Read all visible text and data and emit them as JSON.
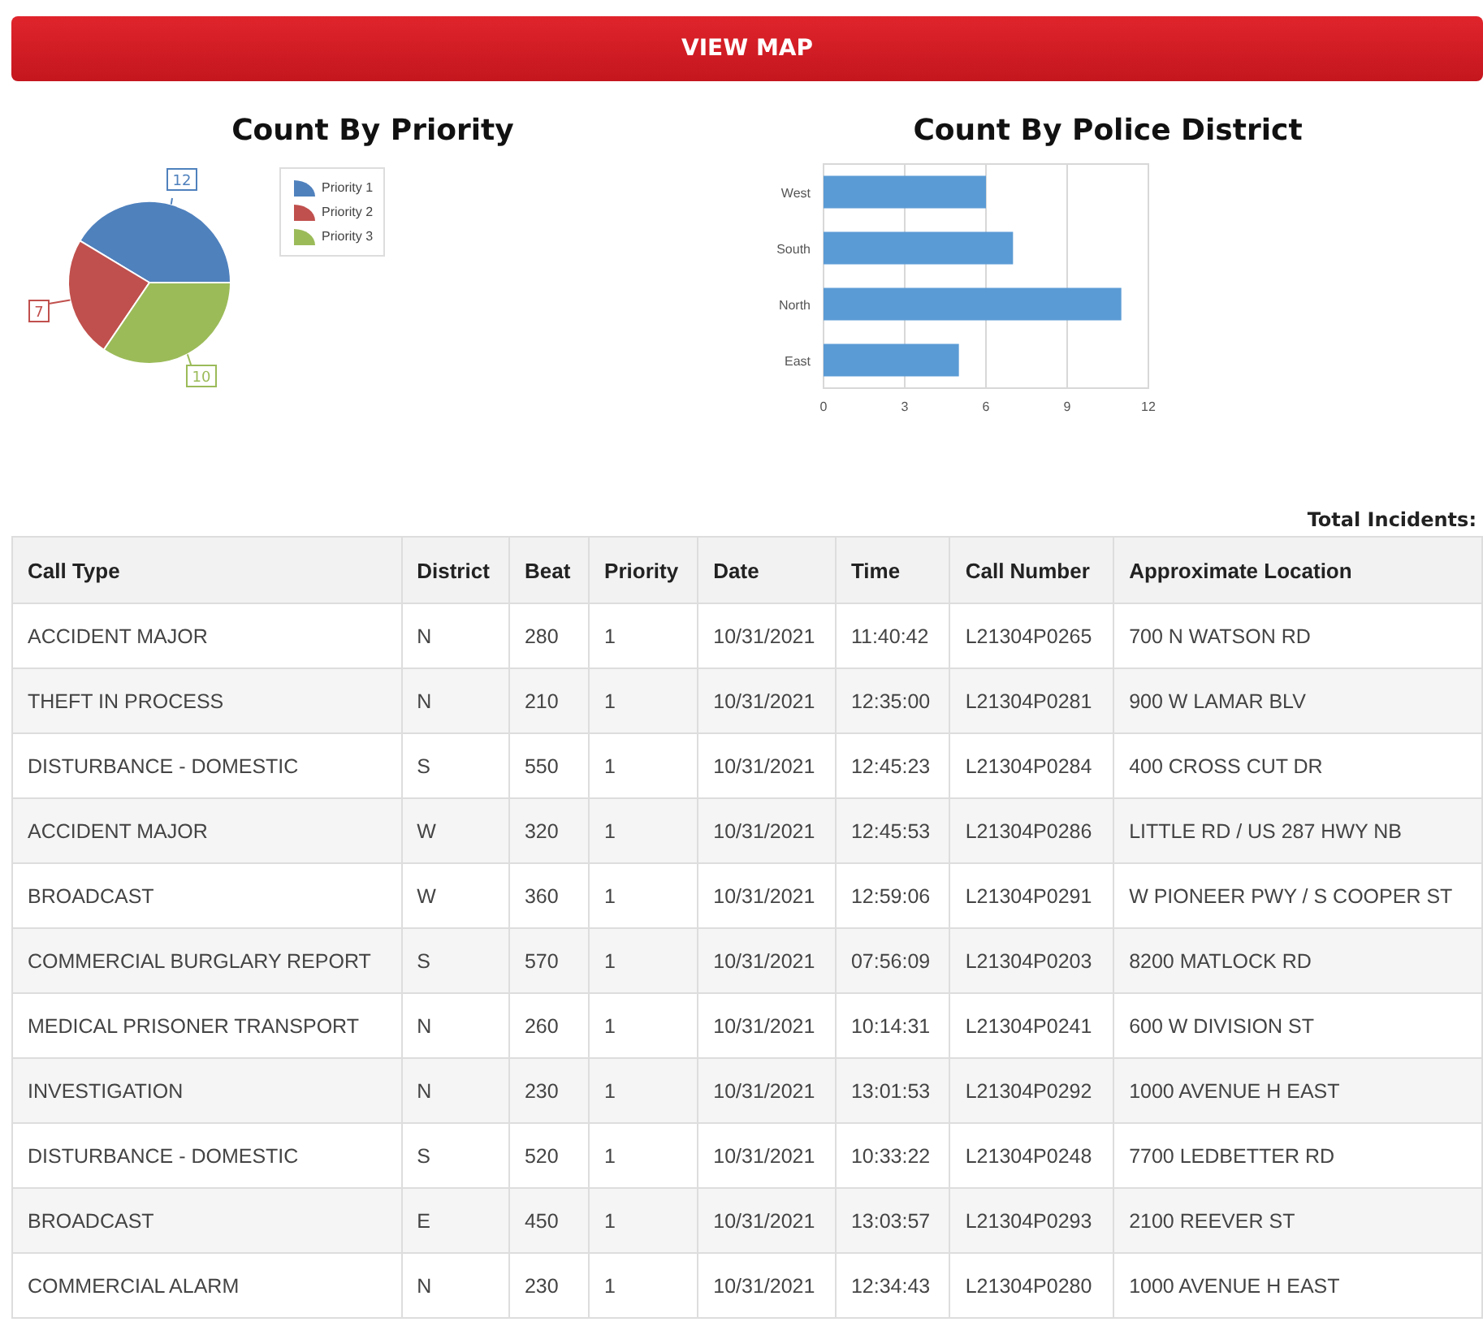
{
  "view_map_button": {
    "label": "VIEW MAP"
  },
  "priority_chart": {
    "chart_data": {
      "type": "pie",
      "title": "Count By Priority",
      "categories": [
        "Priority 1",
        "Priority 2",
        "Priority 3"
      ],
      "series": [
        {
          "values": [
            12,
            7,
            10
          ]
        }
      ],
      "colors": [
        "#4f81bd",
        "#c0504d",
        "#9bbb59"
      ],
      "data_labels": true
    }
  },
  "district_chart": {
    "chart_data": {
      "type": "bar",
      "orientation": "horizontal",
      "title": "Count By Police District",
      "categories": [
        "West",
        "South",
        "North",
        "East"
      ],
      "series": [
        {
          "color": "#5b9bd5",
          "values": [
            6,
            7,
            11,
            5
          ]
        }
      ],
      "grid": true,
      "xlim": [
        0,
        12
      ],
      "xticks": [
        0,
        3,
        6,
        9,
        12
      ]
    }
  },
  "total_incidents": "Total Incidents:",
  "table": {
    "columns": [
      "Call Type",
      "District",
      "Beat",
      "Priority",
      "Date",
      "Time",
      "Call Number",
      "Approximate Location"
    ],
    "rows": [
      [
        "ACCIDENT MAJOR",
        "N",
        "280",
        "1",
        "10/31/2021",
        "11:40:42",
        "L21304P0265",
        "700 N WATSON RD"
      ],
      [
        "THEFT IN PROCESS",
        "N",
        "210",
        "1",
        "10/31/2021",
        "12:35:00",
        "L21304P0281",
        "900 W LAMAR BLV"
      ],
      [
        "DISTURBANCE - DOMESTIC",
        "S",
        "550",
        "1",
        "10/31/2021",
        "12:45:23",
        "L21304P0284",
        "400 CROSS CUT DR"
      ],
      [
        "ACCIDENT MAJOR",
        "W",
        "320",
        "1",
        "10/31/2021",
        "12:45:53",
        "L21304P0286",
        "LITTLE RD / US 287 HWY NB"
      ],
      [
        "BROADCAST",
        "W",
        "360",
        "1",
        "10/31/2021",
        "12:59:06",
        "L21304P0291",
        "W PIONEER PWY / S COOPER ST"
      ],
      [
        "COMMERCIAL BURGLARY REPORT",
        "S",
        "570",
        "1",
        "10/31/2021",
        "07:56:09",
        "L21304P0203",
        "8200 MATLOCK RD"
      ],
      [
        "MEDICAL PRISONER TRANSPORT",
        "N",
        "260",
        "1",
        "10/31/2021",
        "10:14:31",
        "L21304P0241",
        "600 W DIVISION ST"
      ],
      [
        "INVESTIGATION",
        "N",
        "230",
        "1",
        "10/31/2021",
        "13:01:53",
        "L21304P0292",
        "1000 AVENUE H EAST"
      ],
      [
        "DISTURBANCE - DOMESTIC",
        "S",
        "520",
        "1",
        "10/31/2021",
        "10:33:22",
        "L21304P0248",
        "7700 LEDBETTER RD"
      ],
      [
        "BROADCAST",
        "E",
        "450",
        "1",
        "10/31/2021",
        "13:03:57",
        "L21304P0293",
        "2100 REEVER ST"
      ],
      [
        "COMMERCIAL ALARM",
        "N",
        "230",
        "1",
        "10/31/2021",
        "12:34:43",
        "L21304P0280",
        "1000 AVENUE H EAST"
      ]
    ]
  }
}
